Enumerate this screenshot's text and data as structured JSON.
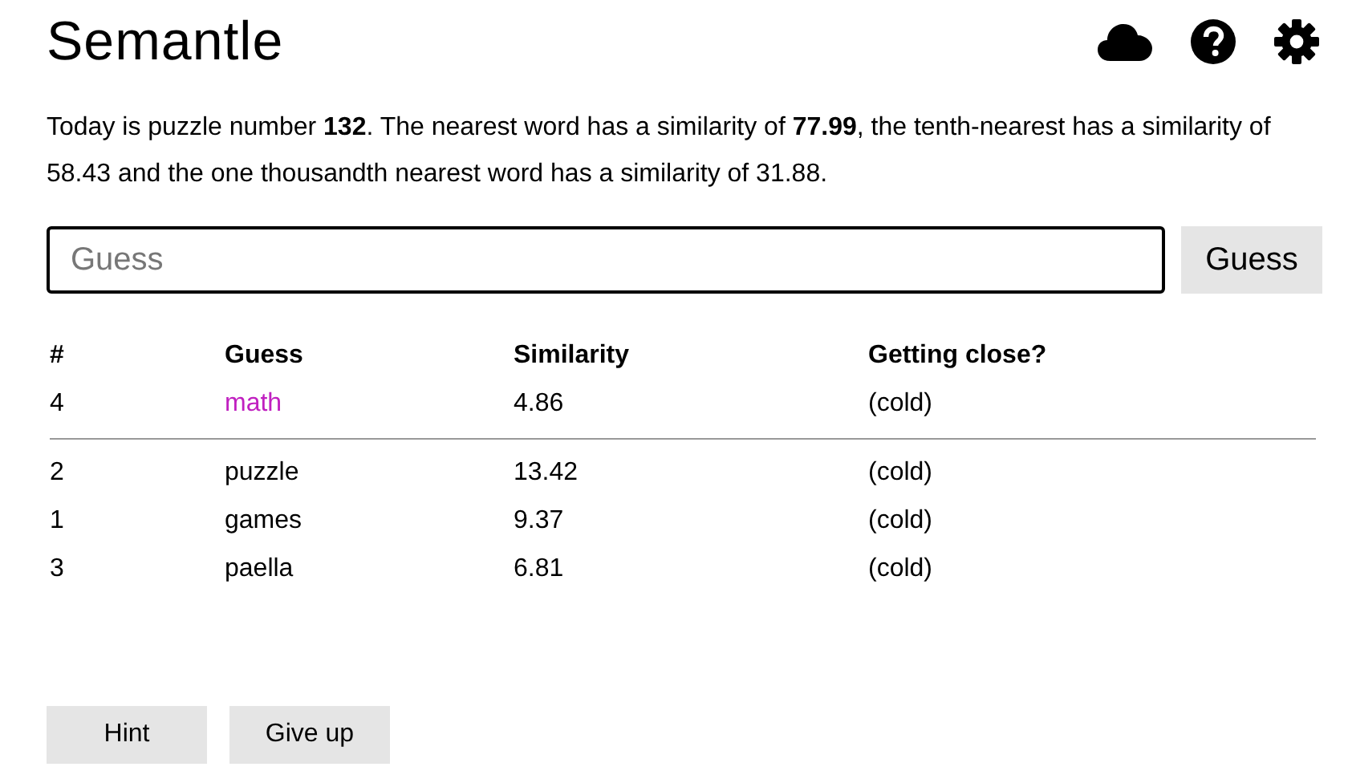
{
  "title": "Semantle",
  "intro": "Today is puzzle number **132**. The nearest word has a similarity of **77.99**, the tenth-nearest has a similarity of 58.43 and the one thousandth nearest word has a similarity of 31.88.",
  "guess_field": {
    "placeholder": "Guess"
  },
  "guess_button": "Guess",
  "table": {
    "columns": [
      "#",
      "Guess",
      "Similarity",
      "Getting close?"
    ],
    "latest": {
      "number": "4",
      "word": "math",
      "similarity": "4.86",
      "closeness": "(cold)"
    },
    "rows": [
      {
        "number": "2",
        "word": "puzzle",
        "similarity": "13.42",
        "closeness": "(cold)"
      },
      {
        "number": "1",
        "word": "games",
        "similarity": "9.37",
        "closeness": "(cold)"
      },
      {
        "number": "3",
        "word": "paella",
        "similarity": "6.81",
        "closeness": "(cold)"
      }
    ]
  },
  "buttons": [
    "Hint",
    "Give up"
  ]
}
